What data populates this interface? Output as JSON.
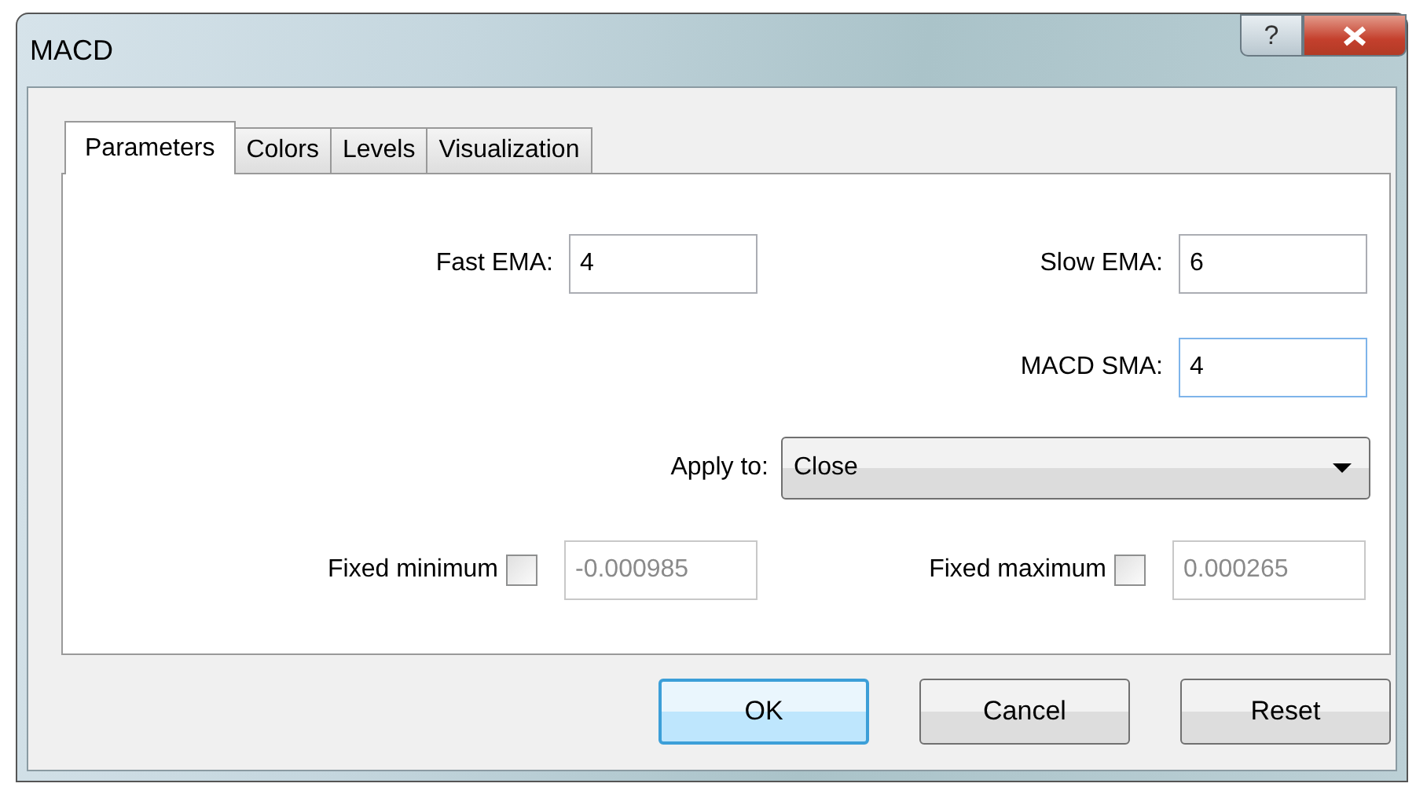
{
  "window": {
    "title": "MACD",
    "help_button": "?"
  },
  "tabs": [
    {
      "label": "Parameters",
      "selected": true
    },
    {
      "label": "Colors",
      "selected": false
    },
    {
      "label": "Levels",
      "selected": false
    },
    {
      "label": "Visualization",
      "selected": false
    }
  ],
  "fields": [
    {
      "label": "Fast EMA:",
      "value": "4",
      "focused": false
    },
    {
      "label": "Slow EMA:",
      "value": "6",
      "focused": false
    },
    {
      "label": "MACD SMA:",
      "value": "4",
      "focused": true
    }
  ],
  "apply_to": {
    "label": "Apply to:",
    "value": "Close"
  },
  "fixed": [
    {
      "label": "Fixed minimum",
      "checked": false,
      "value": "-0.000985"
    },
    {
      "label": "Fixed maximum",
      "checked": false,
      "value": "0.000265"
    }
  ],
  "buttons": [
    {
      "label": "OK",
      "default": true
    },
    {
      "label": "Cancel",
      "default": false
    },
    {
      "label": "Reset",
      "default": false
    }
  ]
}
